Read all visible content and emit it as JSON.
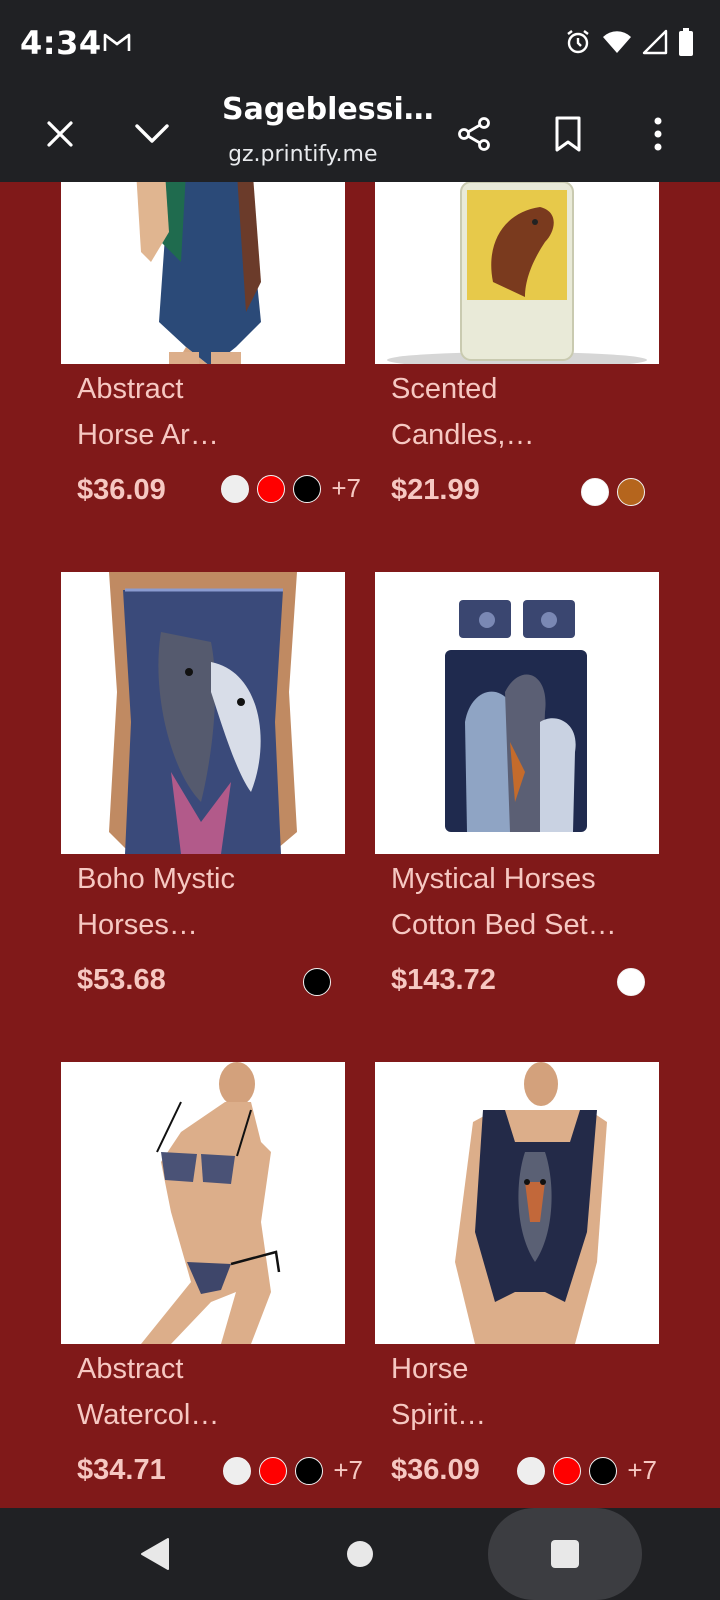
{
  "status_bar": {
    "time": "4:34",
    "mail_icon": "gmail-icon",
    "icons": [
      "alarm-icon",
      "wifi-icon",
      "signal-icon",
      "battery-icon"
    ]
  },
  "toolbar": {
    "title": "Sageblessi…",
    "url": "gz.printify.me"
  },
  "products": [
    {
      "title_line1": "Abstract",
      "title_line2": "Horse Ar…",
      "price": "$36.09",
      "swatches": [
        "#eeeeee",
        "#ff0000",
        "#000000"
      ],
      "more": "+7"
    },
    {
      "title_line1": "Scented",
      "title_line2": "Candles,…",
      "price": "$21.99",
      "swatches": [
        "#ffffff",
        "#b5651d"
      ],
      "more": ""
    },
    {
      "title_line1": "Boho Mystic",
      "title_line2": "Horses…",
      "price": "$53.68",
      "swatches": [
        "#000000"
      ],
      "more": ""
    },
    {
      "title_line1": "Mystical Horses",
      "title_line2": "Cotton Bed Set…",
      "price": "$143.72",
      "swatches": [
        "#ffffff"
      ],
      "more": ""
    },
    {
      "title_line1": "Abstract",
      "title_line2": "Watercol…",
      "price": "$34.71",
      "swatches": [
        "#eeeeee",
        "#ff0000",
        "#000000"
      ],
      "more": "+7"
    },
    {
      "title_line1": "Horse",
      "title_line2": "Spirit…",
      "price": "$36.09",
      "swatches": [
        "#eeeeee",
        "#ff0000",
        "#000000"
      ],
      "more": "+7"
    }
  ],
  "colors": {
    "page_background": "#801919",
    "chrome": "#202124",
    "text_pink": "#f6c8c2"
  }
}
